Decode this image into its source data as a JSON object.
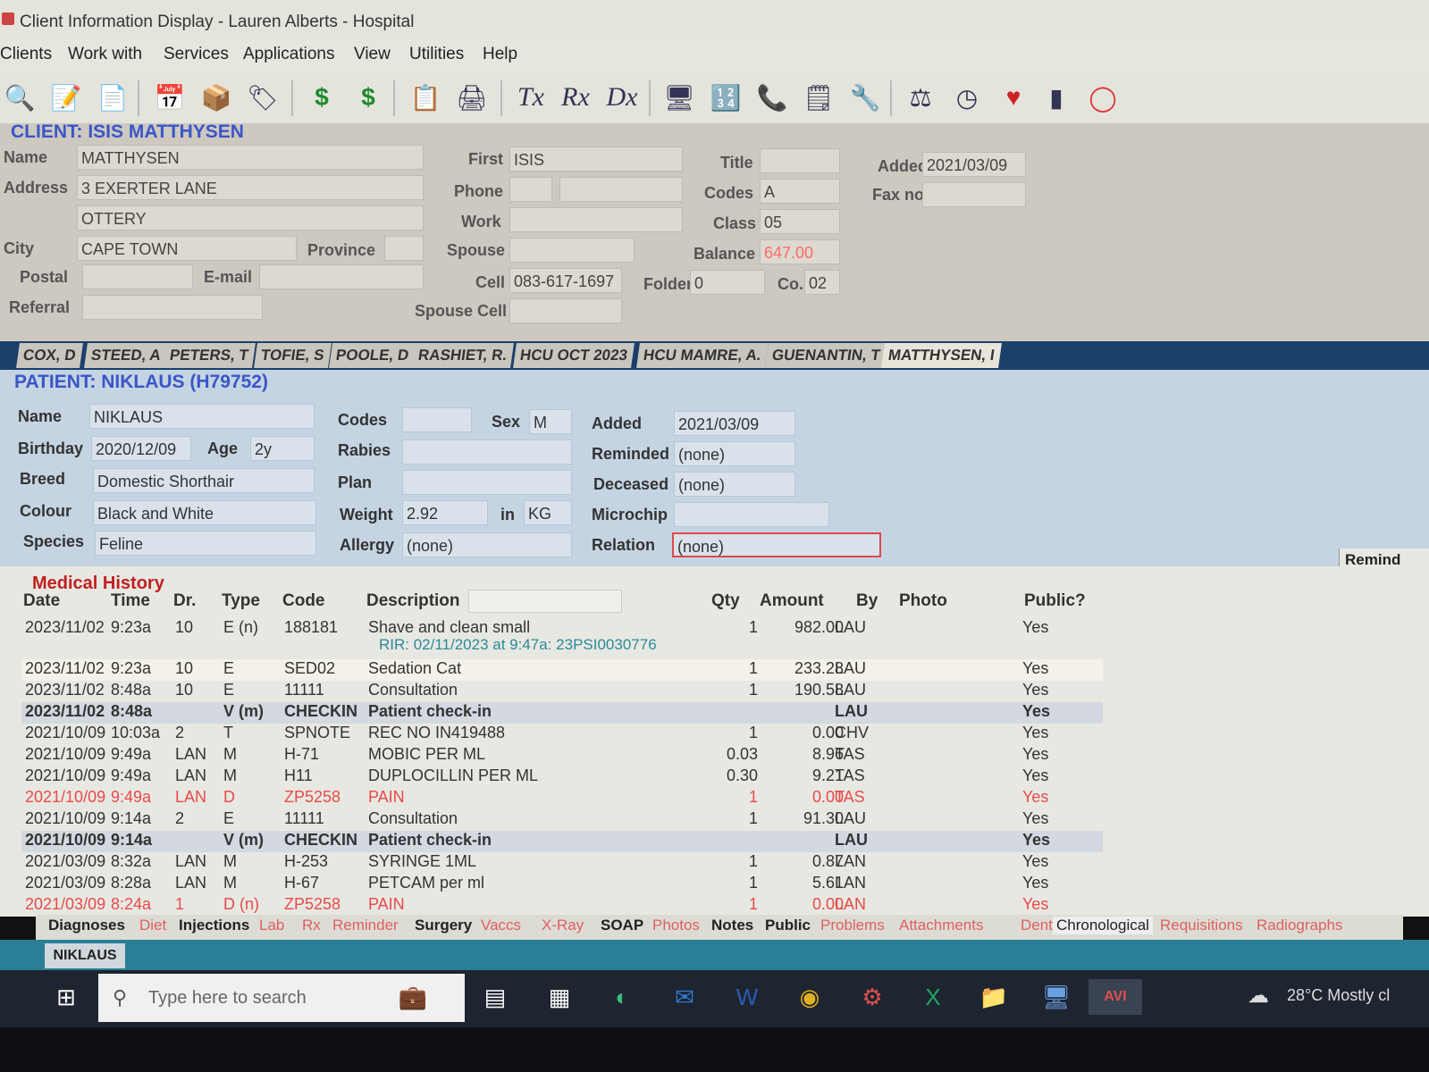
{
  "window": {
    "title": "Client Information Display - Lauren Alberts - Hospital"
  },
  "menu": [
    "Clients",
    "Work with",
    "Services",
    "Applications",
    "View",
    "Utilities",
    "Help"
  ],
  "toolbar_icons": [
    "search-icon",
    "edit-icon",
    "document-icon",
    "calendar-icon",
    "box-icon",
    "tag-icon",
    "dollar-icon",
    "dollar-plus-icon",
    "clipboard-icon",
    "printer-icon",
    "tx-icon",
    "rx-icon",
    "dx-icon",
    "monitor-icon",
    "calculator-icon",
    "phone-icon",
    "notepad-icon",
    "wrench-icon",
    "scale-icon",
    "clock-icon",
    "heartbeat-icon",
    "battery-icon",
    "lifebuoy-icon"
  ],
  "toolbar_text": {
    "tx": "Tx",
    "rx": "Rx",
    "dx": "Dx"
  },
  "client": {
    "section_title": "CLIENT: ISIS MATTHYSEN",
    "labels": {
      "name": "Name",
      "address": "Address",
      "city": "City",
      "province": "Province",
      "postal": "Postal",
      "email": "E-mail",
      "referral": "Referral",
      "first": "First",
      "phone": "Phone",
      "work": "Work",
      "spouse": "Spouse",
      "cell": "Cell",
      "spouse_cell": "Spouse Cell",
      "title": "Title",
      "codes": "Codes",
      "class": "Class",
      "balance": "Balance",
      "folder": "Folder",
      "co": "Co.",
      "added": "Added",
      "fax": "Fax no."
    },
    "name": "MATTHYSEN",
    "address1": "3 EXERTER LANE",
    "address2": "OTTERY",
    "city": "CAPE TOWN",
    "province": "",
    "postal": "",
    "email": "",
    "referral": "",
    "first": "ISIS",
    "phone_code": "",
    "phone": "",
    "work": "",
    "spouse": "",
    "cell": "083-617-1697",
    "spouse_cell": "",
    "title": "",
    "codes": "A",
    "class": "05",
    "balance": "647.00",
    "folder": "0",
    "co": "02",
    "added": "2021/03/09",
    "fax": ""
  },
  "client_tabs": [
    "COX, D",
    "STEED, A",
    "PETERS, T",
    "TOFIE, S",
    "POOLE, D",
    "RASHIET, R.",
    "HCU OCT 2023",
    "HCU MAMRE, A.",
    "GUENANTIN, T",
    "MATTHYSEN, I"
  ],
  "patient": {
    "section_title": "PATIENT: NIKLAUS (H79752)",
    "labels": {
      "name": "Name",
      "birthday": "Birthday",
      "age": "Age",
      "breed": "Breed",
      "colour": "Colour",
      "species": "Species",
      "codes": "Codes",
      "sex": "Sex",
      "rabies": "Rabies",
      "plan": "Plan",
      "weight": "Weight",
      "in": "in",
      "allergy": "Allergy",
      "added": "Added",
      "reminded": "Reminded",
      "deceased": "Deceased",
      "microchip": "Microchip",
      "relation": "Relation"
    },
    "name": "NIKLAUS",
    "birthday": "2020/12/09",
    "age": "2y",
    "breed": "Domestic Shorthair",
    "colour": "Black and White",
    "species": "Feline",
    "codes": "",
    "sex": "M",
    "rabies": "",
    "plan": "",
    "weight": "2.92",
    "weight_unit": "KG",
    "allergy": "(none)",
    "added": "2021/03/09",
    "reminded": "(none)",
    "deceased": "(none)",
    "microchip": "",
    "relation": "(none)",
    "remind_tab": "Remind"
  },
  "medical_history": {
    "title": "Medical History",
    "headers": [
      "Date",
      "Time",
      "Dr.",
      "Type",
      "Code",
      "Description",
      "Qty",
      "Amount",
      "By",
      "Photo",
      "Public?"
    ],
    "rows": [
      {
        "date": "2023/11/02",
        "time": "9:23a",
        "dr": "10",
        "type": "E (n)",
        "code": "188181",
        "desc": "Shave and clean small",
        "qty": "1",
        "amount": "982.00",
        "by": "LAU",
        "public": "Yes",
        "style": "normal",
        "sub": "RIR: 02/11/2023 at 9:47a: 23PSI0030776"
      },
      {
        "date": "2023/11/02",
        "time": "9:23a",
        "dr": "10",
        "type": "E",
        "code": "SED02",
        "desc": "Sedation Cat",
        "qty": "1",
        "amount": "233.28",
        "by": "LAU",
        "public": "Yes",
        "style": "hl"
      },
      {
        "date": "2023/11/02",
        "time": "8:48a",
        "dr": "10",
        "type": "E",
        "code": "11111",
        "desc": "Consultation",
        "qty": "1",
        "amount": "190.58",
        "by": "LAU",
        "public": "Yes",
        "style": "normal"
      },
      {
        "date": "2023/11/02",
        "time": "8:48a",
        "dr": "",
        "type": "V (m)",
        "code": "CHECKIN",
        "desc": "Patient check-in",
        "qty": "",
        "amount": "",
        "by": "LAU",
        "public": "Yes",
        "style": "bold"
      },
      {
        "date": "2021/10/09",
        "time": "10:03a",
        "dr": "2",
        "type": "T",
        "code": "SPNOTE",
        "desc": "REC NO IN419488",
        "qty": "1",
        "amount": "0.00",
        "by": "CHV",
        "public": "Yes",
        "style": "normal"
      },
      {
        "date": "2021/10/09",
        "time": "9:49a",
        "dr": "LAN",
        "type": "M",
        "code": "H-71",
        "desc": "MOBIC PER ML",
        "qty": "0.03",
        "amount": "8.96",
        "by": "TAS",
        "public": "Yes",
        "style": "normal"
      },
      {
        "date": "2021/10/09",
        "time": "9:49a",
        "dr": "LAN",
        "type": "M",
        "code": "H11",
        "desc": "DUPLOCILLIN PER ML",
        "qty": "0.30",
        "amount": "9.21",
        "by": "TAS",
        "public": "Yes",
        "style": "normal"
      },
      {
        "date": "2021/10/09",
        "time": "9:49a",
        "dr": "LAN",
        "type": "D",
        "code": "ZP5258",
        "desc": "PAIN",
        "qty": "1",
        "amount": "0.00",
        "by": "TAS",
        "public": "Yes",
        "style": "red"
      },
      {
        "date": "2021/10/09",
        "time": "9:14a",
        "dr": "2",
        "type": "E",
        "code": "11111",
        "desc": "Consultation",
        "qty": "1",
        "amount": "91.30",
        "by": "LAU",
        "public": "Yes",
        "style": "normal"
      },
      {
        "date": "2021/10/09",
        "time": "9:14a",
        "dr": "",
        "type": "V (m)",
        "code": "CHECKIN",
        "desc": "Patient check-in",
        "qty": "",
        "amount": "",
        "by": "LAU",
        "public": "Yes",
        "style": "bold"
      },
      {
        "date": "2021/03/09",
        "time": "8:32a",
        "dr": "LAN",
        "type": "M",
        "code": "H-253",
        "desc": "SYRINGE 1ML",
        "qty": "1",
        "amount": "0.87",
        "by": "LAN",
        "public": "Yes",
        "style": "normal"
      },
      {
        "date": "2021/03/09",
        "time": "8:28a",
        "dr": "LAN",
        "type": "M",
        "code": "H-67",
        "desc": "PETCAM per ml",
        "qty": "1",
        "amount": "5.61",
        "by": "LAN",
        "public": "Yes",
        "style": "normal"
      },
      {
        "date": "2021/03/09",
        "time": "8:24a",
        "dr": "1",
        "type": "D (n)",
        "code": "ZP5258",
        "desc": "PAIN",
        "qty": "1",
        "amount": "0.00",
        "by": "LAN",
        "public": "Yes",
        "style": "red"
      }
    ]
  },
  "bottom_tabs": [
    {
      "label": "Diagnoses",
      "style": "dark"
    },
    {
      "label": "Diet",
      "style": "red"
    },
    {
      "label": "Injections",
      "style": "dark"
    },
    {
      "label": "Lab",
      "style": "red"
    },
    {
      "label": "Rx",
      "style": "red"
    },
    {
      "label": "Reminder",
      "style": "red"
    },
    {
      "label": "Surgery",
      "style": "dark"
    },
    {
      "label": "Vaccs",
      "style": "red"
    },
    {
      "label": "X-Ray",
      "style": "red"
    },
    {
      "label": "SOAP",
      "style": "dark"
    },
    {
      "label": "Photos",
      "style": "red"
    },
    {
      "label": "Notes",
      "style": "dark"
    },
    {
      "label": "Public",
      "style": "dark"
    },
    {
      "label": "Problems",
      "style": "red"
    },
    {
      "label": "Attachments",
      "style": "red"
    },
    {
      "label": "Dental",
      "style": "red"
    },
    {
      "label": "Chronological",
      "style": "active"
    },
    {
      "label": "Requisitions",
      "style": "red"
    },
    {
      "label": "Radiographs",
      "style": "red"
    }
  ],
  "status_tab": "NIKLAUS",
  "taskbar": {
    "search_placeholder": "Type here to search",
    "weather": "28°C  Mostly cl",
    "icons": [
      "windows-icon",
      "briefcase-icon",
      "task-view-icon",
      "calculator-app-icon",
      "edge-icon",
      "outlook-icon",
      "word-icon",
      "chrome-icon",
      "app-icon",
      "excel-icon",
      "folder-icon",
      "remote-icon",
      "avi-app-icon"
    ],
    "avi_label": "AVI"
  },
  "colors": {
    "client_bg": "#cdc8c0",
    "patient_bg": "#c4d4e2",
    "tabstrip": "#1a3f6a",
    "section_blue": "#3a56c8",
    "history_red": "#c02020",
    "deleted_red": "#e84a4a",
    "statusbar": "#2a7e96",
    "balance_red": "#ff6a6a"
  }
}
